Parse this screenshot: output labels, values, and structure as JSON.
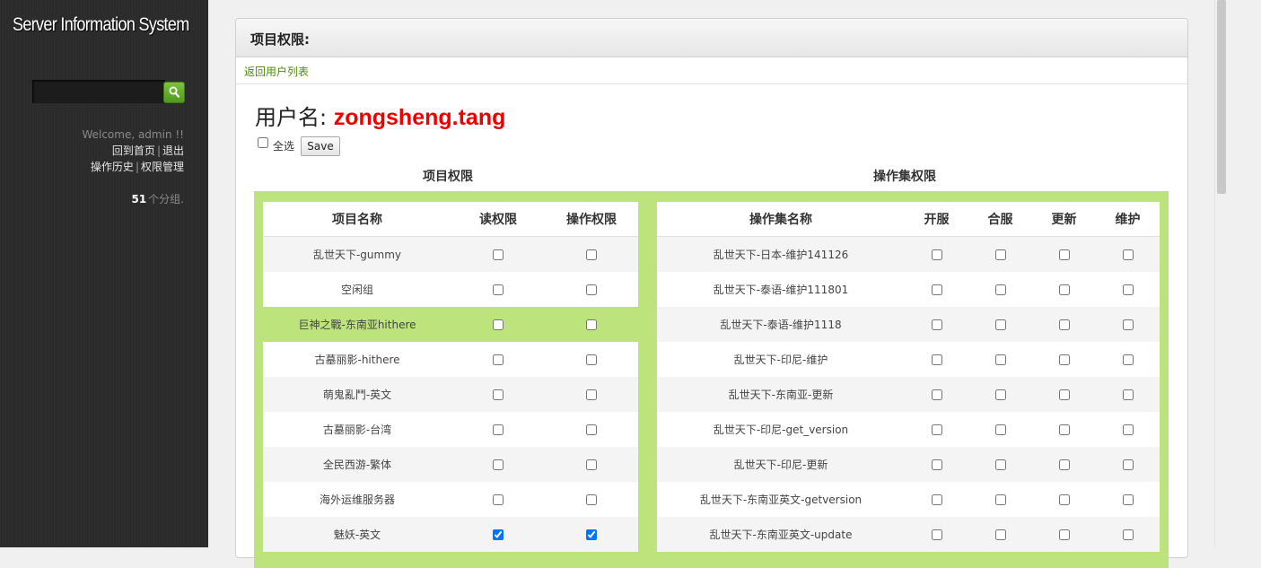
{
  "sidebar": {
    "app_title": "Server Information System",
    "search": {
      "value": "",
      "icon": "search-icon",
      "button_color": "#5ca72a"
    },
    "welcome": "Welcome, admin !!",
    "links": {
      "home": "回到首页",
      "logout": "退出",
      "history": "操作历史",
      "perm_mgmt": "权限管理",
      "sep": "|"
    },
    "group_count": "51",
    "group_count_suffix": "个分组."
  },
  "panel": {
    "title": "项目权限:",
    "back_link": "返回用户列表",
    "user_label": "用户名: ",
    "user_name": "zongsheng.tang",
    "select_all_label": "全选",
    "save_label": "Save",
    "section_project": "项目权限",
    "section_opset": "操作集权限"
  },
  "colors": {
    "accent_green": "#bde47c",
    "username_red": "#e00000",
    "link_green": "#4f8a10"
  },
  "project_table": {
    "headers": [
      "项目名称",
      "读权限",
      "操作权限"
    ],
    "rows": [
      {
        "name": "乱世天下-gummy",
        "read": false,
        "operate": false
      },
      {
        "name": "空闲组",
        "read": false,
        "operate": false
      },
      {
        "name": "巨神之戰-东南亚hithere",
        "read": false,
        "operate": false,
        "highlighted": true
      },
      {
        "name": "古墓丽影-hithere",
        "read": false,
        "operate": false
      },
      {
        "name": "萌鬼亂鬥-英文",
        "read": false,
        "operate": false
      },
      {
        "name": "古墓丽影-台湾",
        "read": false,
        "operate": false
      },
      {
        "name": "全民西游-繁体",
        "read": false,
        "operate": false
      },
      {
        "name": "海外运维服务器",
        "read": false,
        "operate": false
      },
      {
        "name": "魅妖-英文",
        "read": true,
        "operate": true
      }
    ]
  },
  "opset_table": {
    "headers": [
      "操作集名称",
      "开服",
      "合服",
      "更新",
      "维护"
    ],
    "rows": [
      {
        "name": "乱世天下-日本-维护141126",
        "values": [
          false,
          false,
          false,
          false
        ]
      },
      {
        "name": "乱世天下-泰语-维护111801",
        "values": [
          false,
          false,
          false,
          false
        ]
      },
      {
        "name": "乱世天下-泰语-维护1118",
        "values": [
          false,
          false,
          false,
          false
        ]
      },
      {
        "name": "乱世天下-印尼-维护",
        "values": [
          false,
          false,
          false,
          false
        ]
      },
      {
        "name": "乱世天下-东南亚-更新",
        "values": [
          false,
          false,
          false,
          false
        ]
      },
      {
        "name": "乱世天下-印尼-get_version",
        "values": [
          false,
          false,
          false,
          false
        ]
      },
      {
        "name": "乱世天下-印尼-更新",
        "values": [
          false,
          false,
          false,
          false
        ]
      },
      {
        "name": "乱世天下-东南亚英文-getversion",
        "values": [
          false,
          false,
          false,
          false
        ]
      },
      {
        "name": "乱世天下-东南亚英文-update",
        "values": [
          false,
          false,
          false,
          false
        ]
      }
    ]
  }
}
